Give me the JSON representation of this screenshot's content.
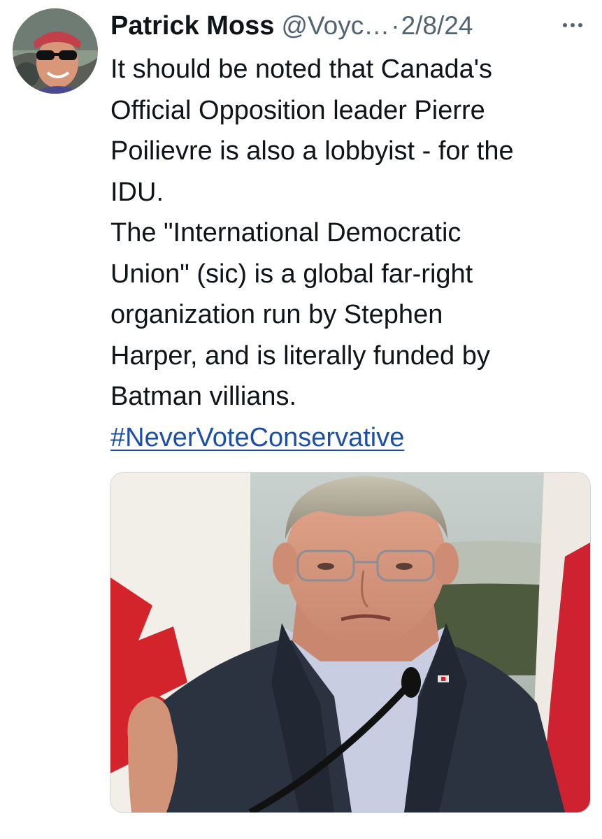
{
  "tweet": {
    "author": {
      "display_name": "Patrick Moss",
      "handle": "@Voyc…",
      "avatar_icon": "profile-photo-avatar"
    },
    "separator": "·",
    "timestamp": "2/8/24",
    "more_icon": "more-horizontal-icon",
    "text_lines": [
      "It should be noted that Canada's",
      "Official Opposition leader Pierre",
      "Poilievre is also a lobbyist - for the",
      "IDU.",
      "The \"International Democratic",
      "Union\" (sic) is a global far-right",
      "organization run by Stephen",
      "Harper, and is literally funded by",
      "Batman villians."
    ],
    "hashtag": "#NeverVoteConservative",
    "media": {
      "icon": "attached-photo"
    }
  },
  "colors": {
    "text": "#0f1419",
    "secondary": "#536471",
    "link": "#1d4fa3",
    "border": "#cfd9de"
  }
}
